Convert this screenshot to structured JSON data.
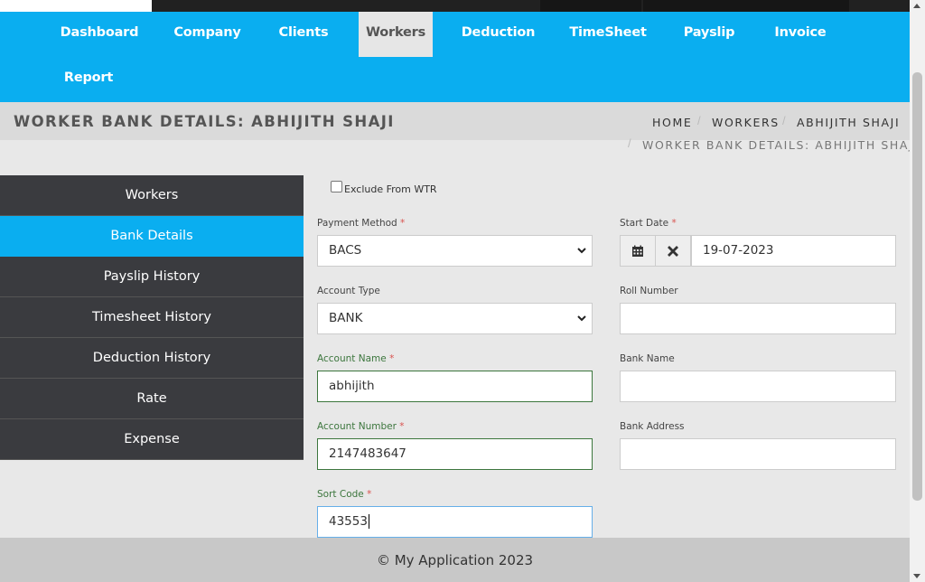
{
  "nav": {
    "items": [
      {
        "label": "Dashboard"
      },
      {
        "label": "Company"
      },
      {
        "label": "Clients"
      },
      {
        "label": "Workers"
      },
      {
        "label": "Deduction"
      },
      {
        "label": "TimeSheet"
      },
      {
        "label": "Payslip"
      },
      {
        "label": "Invoice"
      },
      {
        "label": "Report"
      }
    ],
    "active": "Workers"
  },
  "header": {
    "title": "WORKER BANK DETAILS: ABHIJITH SHAJI",
    "breadcrumb": [
      "HOME",
      "WORKERS",
      "ABHIJITH SHAJI",
      "WORKER BANK DETAILS: ABHIJITH SHAJI"
    ]
  },
  "sidebar": {
    "items": [
      {
        "label": "Workers"
      },
      {
        "label": "Bank Details"
      },
      {
        "label": "Payslip History"
      },
      {
        "label": "Timesheet History"
      },
      {
        "label": "Deduction History"
      },
      {
        "label": "Rate"
      },
      {
        "label": "Expense"
      }
    ],
    "active": "Bank Details"
  },
  "form": {
    "exclude_label": "Exclude From WTR",
    "exclude_checked": false,
    "payment_method": {
      "label": "Payment Method",
      "required": "*",
      "value": "BACS"
    },
    "start_date": {
      "label": "Start Date",
      "required": "*",
      "value": "19-07-2023"
    },
    "account_type": {
      "label": "Account Type",
      "value": "BANK"
    },
    "roll_number": {
      "label": "Roll Number",
      "value": ""
    },
    "account_name": {
      "label": "Account Name",
      "required": "*",
      "value": "abhijith"
    },
    "bank_name": {
      "label": "Bank Name",
      "value": ""
    },
    "account_number": {
      "label": "Account Number",
      "required": "*",
      "value": "2147483647"
    },
    "bank_address": {
      "label": "Bank Address",
      "value": ""
    },
    "sort_code": {
      "label": "Sort Code",
      "required": "*",
      "value": "43553"
    }
  },
  "footer": {
    "text": "© My Application 2023"
  },
  "colors": {
    "brand": "#0aaef0",
    "sidebar": "#3a3b3f",
    "valid": "#3c763d",
    "required": "#d9534f"
  }
}
